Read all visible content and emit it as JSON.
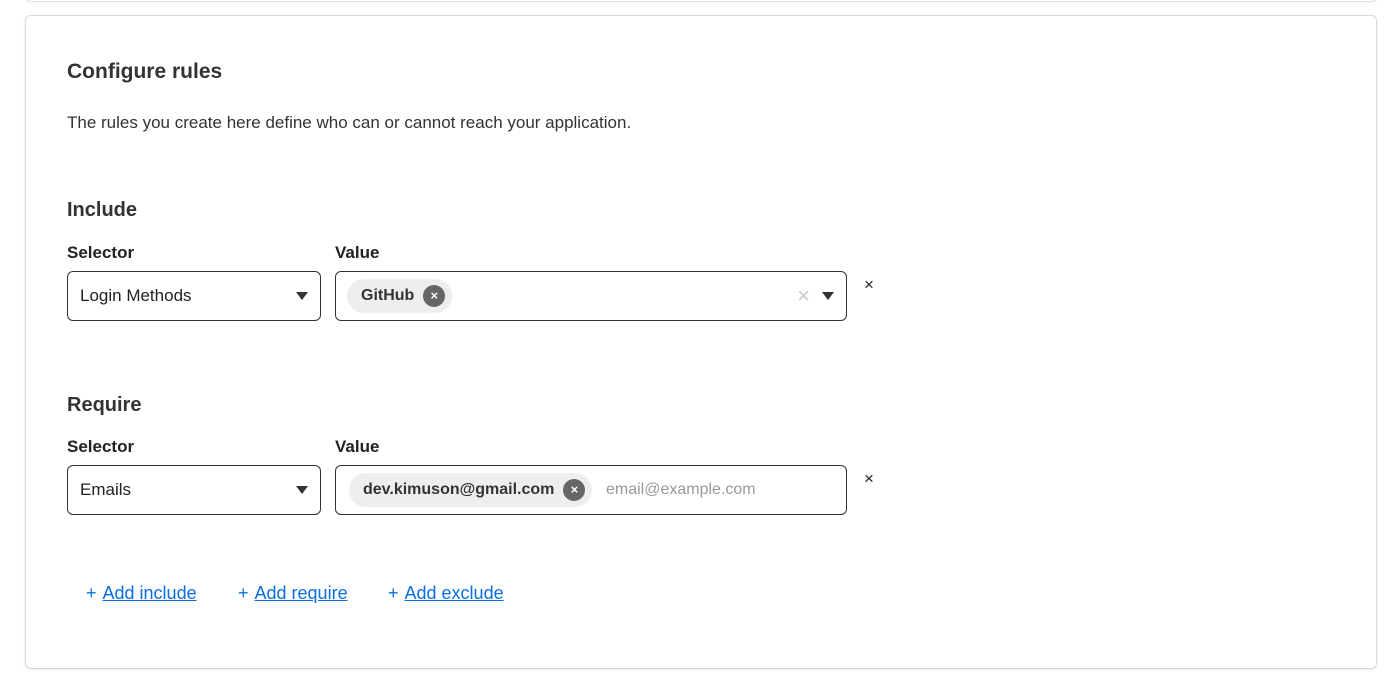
{
  "header": {
    "title": "Configure rules",
    "description": "The rules you create here define who can or cannot reach your application."
  },
  "include": {
    "heading": "Include",
    "selector_label": "Selector",
    "value_label": "Value",
    "selector_value": "Login Methods",
    "chip": "GitHub",
    "chip_remove": "×",
    "clear": "×",
    "remove_row": "×"
  },
  "require": {
    "heading": "Require",
    "selector_label": "Selector",
    "value_label": "Value",
    "selector_value": "Emails",
    "chip": "dev.kimuson@gmail.com",
    "chip_remove": "×",
    "input_placeholder": "email@example.com",
    "remove_row": "×"
  },
  "actions": {
    "plus": "+",
    "add_include": "Add include",
    "add_require": "Add require",
    "add_exclude": "Add exclude"
  }
}
